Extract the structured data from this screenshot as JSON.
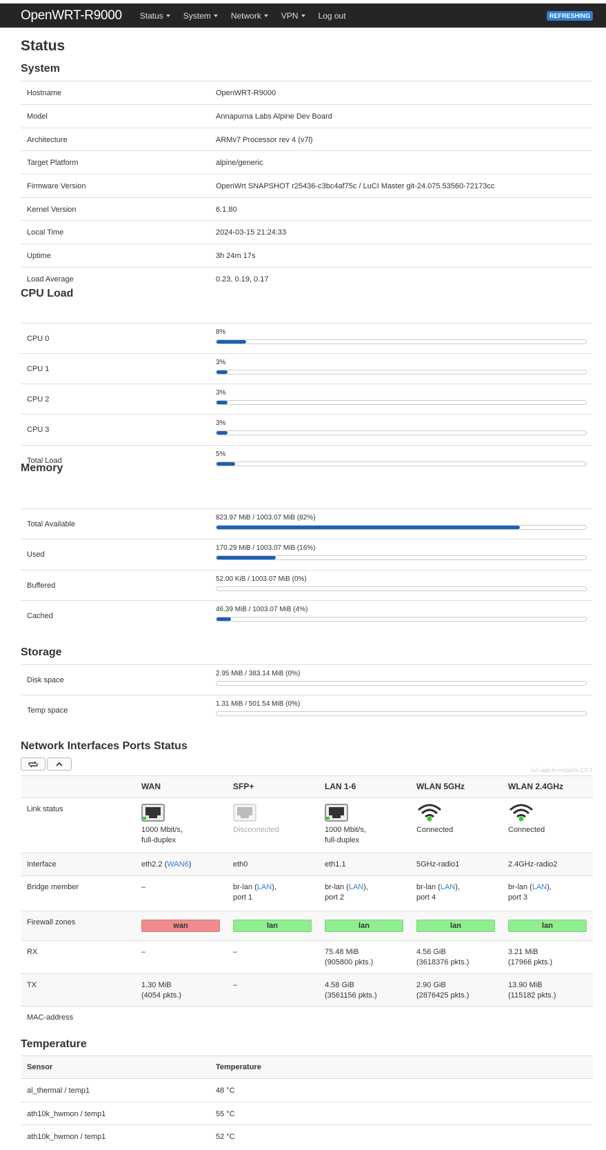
{
  "header": {
    "brand": "OpenWRT-R9000",
    "menu": [
      "Status",
      "System",
      "Network",
      "VPN",
      "Log out"
    ],
    "refresh_badge": "REFRESHING"
  },
  "page_title": "Status",
  "system": {
    "title": "System",
    "rows": [
      {
        "label": "Hostname",
        "value": "OpenWRT-R9000"
      },
      {
        "label": "Model",
        "value": "Annapurna Labs Alpine Dev Board"
      },
      {
        "label": "Architecture",
        "value": "ARMv7 Processor rev 4 (v7l)"
      },
      {
        "label": "Target Platform",
        "value": "alpine/generic"
      },
      {
        "label": "Firmware Version",
        "value": "OpenWrt SNAPSHOT r25436-c3bc4af75c / LuCI Master git-24.075.53560-72173cc"
      },
      {
        "label": "Kernel Version",
        "value": "6.1.80"
      },
      {
        "label": "Local Time",
        "value": "2024-03-15 21:24:33"
      },
      {
        "label": "Uptime",
        "value": "3h 24m 17s"
      },
      {
        "label": "Load Average",
        "value": "0.23, 0.19, 0.17"
      }
    ]
  },
  "cpu": {
    "title": "CPU Load",
    "rows": [
      {
        "label": "CPU 0",
        "text": "8%",
        "fraction": 0.08
      },
      {
        "label": "CPU 1",
        "text": "3%",
        "fraction": 0.03
      },
      {
        "label": "CPU 2",
        "text": "3%",
        "fraction": 0.03
      },
      {
        "label": "CPU 3",
        "text": "3%",
        "fraction": 0.03
      },
      {
        "label": "Total Load",
        "text": "5%",
        "fraction": 0.05
      }
    ]
  },
  "memory": {
    "title": "Memory",
    "rows": [
      {
        "label": "Total Available",
        "text": "823.97 MiB / 1003.07 MiB (82%)",
        "fraction": 0.82
      },
      {
        "label": "Used",
        "text": "170.29 MiB / 1003.07 MiB (16%)",
        "fraction": 0.16
      },
      {
        "label": "Buffered",
        "text": "52.00 KiB / 1003.07 MiB (0%)",
        "fraction": 0.0
      },
      {
        "label": "Cached",
        "text": "46.39 MiB / 1003.07 MiB (4%)",
        "fraction": 0.04
      }
    ]
  },
  "storage": {
    "title": "Storage",
    "rows": [
      {
        "label": "Disk space",
        "text": "2.95 MiB / 383.14 MiB (0%)",
        "fraction": 0.0
      },
      {
        "label": "Temp space",
        "text": "1.31 MiB / 501.54 MiB (0%)",
        "fraction": 0.0
      }
    ]
  },
  "netports": {
    "title": "Network Interfaces Ports Status",
    "plugin_version": "luci-app-tn-netports 2.0.3",
    "row_labels": {
      "link_status": "Link status",
      "interface": "Interface",
      "bridge_member": "Bridge member",
      "firewall_zones": "Firewall zones",
      "rx": "RX",
      "tx": "TX",
      "mac": "MAC-address"
    },
    "ports": [
      {
        "name": "WAN",
        "icon": "ethernet-port-icon",
        "connected": true,
        "status1": "1000 Mbit/s,",
        "status2": "full-duplex",
        "iface": "eth2.2 (",
        "iface_link": "WAN6",
        "iface_end": ")",
        "bridge1": "–",
        "bridge_link": "",
        "bridge_end": "",
        "bridge2": "",
        "zone": "wan",
        "zone_color": "#f08c8c",
        "rx1": "–",
        "rx2": "",
        "tx1": "1.30 MiB",
        "tx2": "(4054 pkts.)"
      },
      {
        "name": "SFP+",
        "icon": "sfp-port-icon",
        "connected": false,
        "status1": "Disconnected",
        "status2": "",
        "iface": "eth0",
        "iface_link": "",
        "iface_end": "",
        "bridge1": "br-lan (",
        "bridge_link": "LAN",
        "bridge_end": "),",
        "bridge2": "port 1",
        "zone": "lan",
        "zone_color": "#90ee90",
        "rx1": "–",
        "rx2": "",
        "tx1": "–",
        "tx2": ""
      },
      {
        "name": "LAN 1-6",
        "icon": "ethernet-port-icon",
        "connected": true,
        "status1": "1000 Mbit/s,",
        "status2": "full-duplex",
        "iface": "eth1.1",
        "iface_link": "",
        "iface_end": "",
        "bridge1": "br-lan (",
        "bridge_link": "LAN",
        "bridge_end": "),",
        "bridge2": "port 2",
        "zone": "lan",
        "zone_color": "#90ee90",
        "rx1": "75.48 MiB",
        "rx2": "(905800 pkts.)",
        "tx1": "4.58 GiB",
        "tx2": "(3561156 pkts.)"
      },
      {
        "name": "WLAN 5GHz",
        "icon": "wifi-icon",
        "connected": true,
        "status1": "Connected",
        "status2": "",
        "iface": "5GHz-radio1",
        "iface_link": "",
        "iface_end": "",
        "bridge1": "br-lan (",
        "bridge_link": "LAN",
        "bridge_end": "),",
        "bridge2": "port 4",
        "zone": "lan",
        "zone_color": "#90ee90",
        "rx1": "4.56 GiB",
        "rx2": "(3618376 pkts.)",
        "tx1": "2.90 GiB",
        "tx2": "(2876425 pkts.)"
      },
      {
        "name": "WLAN 2.4GHz",
        "icon": "wifi-icon",
        "connected": true,
        "status1": "Connected",
        "status2": "",
        "iface": "2.4GHz-radio2",
        "iface_link": "",
        "iface_end": "",
        "bridge1": "br-lan (",
        "bridge_link": "LAN",
        "bridge_end": "),",
        "bridge2": "port 3",
        "zone": "lan",
        "zone_color": "#90ee90",
        "rx1": "3.21 MiB",
        "rx2": "(17966 pkts.)",
        "tx1": "13.90 MiB",
        "tx2": "(115182 pkts.)"
      }
    ]
  },
  "temperature": {
    "title": "Temperature",
    "headers": {
      "sensor": "Sensor",
      "temp": "Temperature"
    },
    "rows": [
      {
        "sensor": "al_thermal / temp1",
        "value": "48 °C"
      },
      {
        "sensor": "ath10k_hwmon / temp1",
        "value": "55 °C"
      },
      {
        "sensor": "ath10k_hwmon / temp1",
        "value": "52 °C"
      }
    ]
  },
  "colors": {
    "accent": "#1d5fb5",
    "link": "#2f7fd6",
    "navbar": "#252525",
    "wan_zone": "#f08c8c",
    "lan_zone": "#90ee90"
  }
}
